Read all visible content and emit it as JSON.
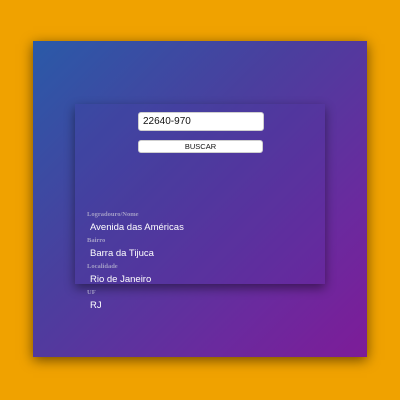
{
  "search": {
    "cep_value": "22640-970",
    "button_label": "BUSCAR"
  },
  "result": {
    "logradouro_label": "Logradouro/Nome",
    "logradouro_value": "Avenida das Américas",
    "bairro_label": "Bairro",
    "bairro_value": "Barra da Tijuca",
    "localidade_label": "Localidade",
    "localidade_value": "Rio de Janeiro",
    "uf_label": "UF",
    "uf_value": "RJ"
  },
  "colors": {
    "page_background": "#f0a200",
    "gradient_start": "#2a5aa8",
    "gradient_end": "#7d1c98",
    "label_color": "#a29cc6",
    "value_color": "#ffffff"
  }
}
